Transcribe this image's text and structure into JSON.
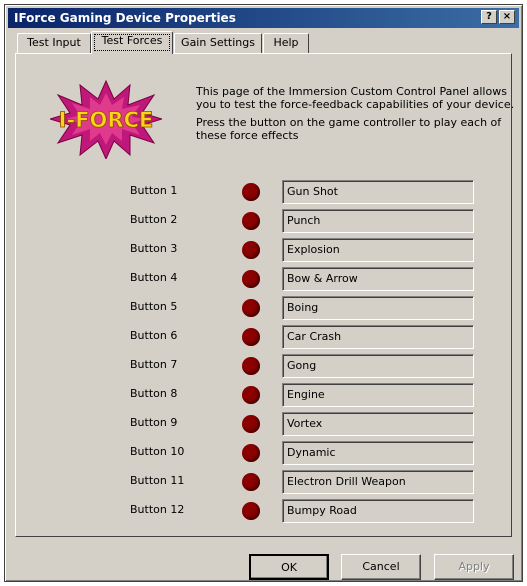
{
  "window": {
    "title": "IForce Gaming Device Properties",
    "help_glyph": "?",
    "close_glyph": "×"
  },
  "tabs": [
    {
      "label": "Test Input"
    },
    {
      "label": "Test Forces",
      "active": true
    },
    {
      "label": "Gain Settings"
    },
    {
      "label": "Help"
    }
  ],
  "logo": {
    "text": "I-FORCE"
  },
  "description": {
    "line1": "This page of the Immersion Custom Control Panel allows you to test the force-feedback capabilities of your device.",
    "line2": "Press the button on the game controller to play each of these force effects"
  },
  "effects": [
    {
      "button": "Button 1",
      "effect": "Gun Shot"
    },
    {
      "button": "Button 2",
      "effect": "Punch"
    },
    {
      "button": "Button 3",
      "effect": "Explosion"
    },
    {
      "button": "Button 4",
      "effect": "Bow & Arrow"
    },
    {
      "button": "Button 5",
      "effect": "Boing"
    },
    {
      "button": "Button 6",
      "effect": "Car Crash"
    },
    {
      "button": "Button 7",
      "effect": "Gong"
    },
    {
      "button": "Button 8",
      "effect": "Engine"
    },
    {
      "button": "Button 9",
      "effect": "Vortex"
    },
    {
      "button": "Button 10",
      "effect": "Dynamic"
    },
    {
      "button": "Button 11",
      "effect": "Electron Drill Weapon"
    },
    {
      "button": "Button 12",
      "effect": "Bumpy Road"
    }
  ],
  "buttons": {
    "ok": "OK",
    "cancel": "Cancel",
    "apply": "Apply"
  },
  "colors": {
    "indicator": "#8b0000",
    "titlebar": "#0a246a",
    "face": "#d4d0c8"
  }
}
